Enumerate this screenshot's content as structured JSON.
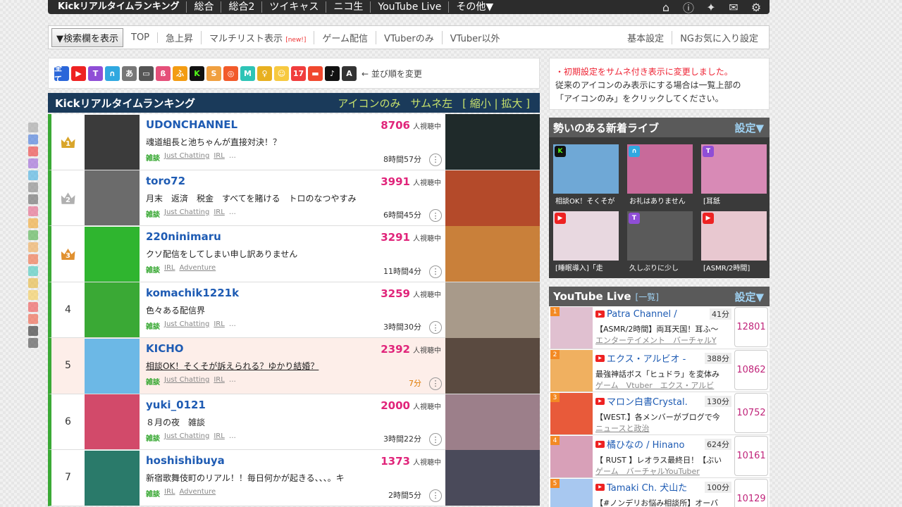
{
  "topnav": {
    "items": [
      "Kickリアルタイムランキング",
      "総合",
      "総合2",
      "ツイキャス",
      "ニコ生",
      "YouTube Live",
      "その他▼"
    ],
    "icons": [
      "home-icon",
      "info-icon",
      "twitter-icon",
      "mail-icon",
      "gear-icon"
    ]
  },
  "submenu": {
    "search_button": "▼検索欄を表示",
    "left": [
      "TOP",
      "急上昇",
      "マルチリスト表示",
      "ゲーム配信",
      "VTuberのみ",
      "VTuber以外"
    ],
    "new_badge": "[new!]",
    "right": [
      "基本設定",
      "NGお気に入り設定"
    ]
  },
  "platforms": {
    "icons": [
      {
        "name": "all-icon",
        "label": "全て",
        "color": "#2a66d9"
      },
      {
        "name": "youtube-icon",
        "label": "▶",
        "color": "#e22"
      },
      {
        "name": "twitch-icon",
        "label": "T",
        "color": "#8f4ed6"
      },
      {
        "name": "openrec-icon",
        "label": "∩",
        "color": "#30a8e0"
      },
      {
        "name": "whowatch-icon",
        "label": "あ",
        "color": "#777"
      },
      {
        "name": "niconico-icon",
        "label": "▭",
        "color": "#555"
      },
      {
        "name": "mildom-icon",
        "label": "ß",
        "color": "#e5507a"
      },
      {
        "name": "furu-icon",
        "label": "ふ",
        "color": "#f39c12"
      },
      {
        "name": "kick-icon",
        "label": "K",
        "color": "#53fc18"
      },
      {
        "name": "showroom-icon",
        "label": "S",
        "color": "#f0a040"
      },
      {
        "name": "17live-circle-icon",
        "label": "◎",
        "color": "#f25a2a"
      },
      {
        "name": "mirrativ-icon",
        "label": "M",
        "color": "#2ec4b6"
      },
      {
        "name": "bulb-icon",
        "label": "♀",
        "color": "#e8b020"
      },
      {
        "name": "pococha-icon",
        "label": "☺",
        "color": "#f7c940"
      },
      {
        "name": "seventeen-icon",
        "label": "17",
        "color": "#f03d3d"
      },
      {
        "name": "line-live-icon",
        "label": "▬",
        "color": "#f0482e"
      },
      {
        "name": "tiktok-icon",
        "label": "♪",
        "color": "#111"
      },
      {
        "name": "twitcasting-icon",
        "label": "A",
        "color": "#333"
      }
    ],
    "sort_link": "← 並び順を変更"
  },
  "ranking": {
    "title": "Kickリアルタイムランキング",
    "options": [
      "アイコンのみ",
      "サムネ左",
      "[ 縮小 | 拡大 ]"
    ],
    "viewers_label": "人視聴中",
    "genre_label": "雑談",
    "rows": [
      {
        "rank": "1",
        "crown": "1",
        "name": "UDONCHANNEL",
        "viewers": "8706",
        "title": "魂道組長と池ちゃんが直接対決！？",
        "tags": [
          "Just Chatting",
          "IRL",
          "…"
        ],
        "duration": "8時間57分",
        "avatar": "#3b3b3b",
        "thumb": "#1f2a2a",
        "highlight": false
      },
      {
        "rank": "2",
        "crown": "2",
        "name": "toro72",
        "viewers": "3991",
        "title": "月末　返済　税金　すべてを賭ける　トロのなつやすみ",
        "tags": [
          "Just Chatting",
          "IRL",
          "…"
        ],
        "duration": "6時間45分",
        "avatar": "#6b6b6b",
        "thumb": "#b44a2a",
        "highlight": false
      },
      {
        "rank": "3",
        "crown": "3",
        "name": "220ninimaru",
        "viewers": "3291",
        "title": "クソ配信をしてしまい申し訳ありません",
        "tags": [
          "IRL",
          "Adventure"
        ],
        "duration": "11時間4分",
        "avatar": "#2fb52f",
        "thumb": "#c9803a",
        "highlight": false
      },
      {
        "rank": "4",
        "crown": "",
        "name": "komachik1221k",
        "viewers": "3259",
        "title": "色々ある配信界",
        "tags": [
          "Just Chatting",
          "IRL",
          "…"
        ],
        "duration": "3時間30分",
        "avatar": "#3aa935",
        "thumb": "#a89a8a",
        "highlight": false
      },
      {
        "rank": "5",
        "crown": "",
        "name": "KICHO",
        "viewers": "2392",
        "title": "相談OK！そくそが訴えられる？ゆかり結婚？",
        "tags": [
          "Just Chatting",
          "IRL",
          "…"
        ],
        "duration": "7分",
        "avatar": "#6cb8e6",
        "thumb": "#5a4a40",
        "highlight": true
      },
      {
        "rank": "6",
        "crown": "",
        "name": "yuki_0121",
        "viewers": "2000",
        "title": "８月の夜　雑談",
        "tags": [
          "Just Chatting",
          "IRL",
          "…"
        ],
        "duration": "3時間22分",
        "avatar": "#d24a6a",
        "thumb": "#9c7f8a",
        "highlight": false
      },
      {
        "rank": "7",
        "crown": "",
        "name": "hoshishibuya",
        "viewers": "1373",
        "title": "新宿歌舞伎町のリアル！！毎日何かが起きる、、、。キ",
        "tags": [
          "IRL",
          "Adventure"
        ],
        "duration": "2時間5分",
        "avatar": "#2a7a6a",
        "thumb": "#4a4a5a",
        "highlight": false
      }
    ]
  },
  "notice": {
    "line1": "・初期設定をサムネ付き表示に変更しました。",
    "line2": "従来のアイコンのみ表示にする場合は一覧上部の",
    "line3": "「アイコンのみ」をクリックしてください。"
  },
  "newlive": {
    "title": "勢いのある新着ライブ",
    "setting": "設定▼",
    "cards": [
      {
        "caption": "相談OK！そくそが",
        "badge": "K",
        "badge_color": "#53fc18",
        "img": "#6fa8d6"
      },
      {
        "caption": "お礼はありません",
        "badge": "∩",
        "badge_color": "#30a8e0",
        "img": "#c86a9a"
      },
      {
        "caption": "[耳舐",
        "badge": "T",
        "badge_color": "#8f4ed6",
        "img": "#d88ab6"
      },
      {
        "caption": "[睡眠導入]「走",
        "badge": "▶",
        "badge_color": "#e22",
        "img": "#e8d8e0"
      },
      {
        "caption": "久しぶりに少し",
        "badge": "T",
        "badge_color": "#8f4ed6",
        "img": "#5a5a5a"
      },
      {
        "caption": "[ASMR/2時間]",
        "badge": "▶",
        "badge_color": "#e22",
        "img": "#e8c8d0"
      }
    ]
  },
  "youtube": {
    "title": "YouTube Live",
    "more": "[一覧]",
    "setting": "設定▼",
    "items": [
      {
        "rank": "1",
        "channel": "Patra Channel /",
        "mins": "41分",
        "title": "【ASMR/2時間】両耳天国！耳ふ〜",
        "category": "エンターテイメント　バーチャルY",
        "count": "12801",
        "img": "#e0c0d0"
      },
      {
        "rank": "2",
        "channel": "エクス・アルビオ -",
        "mins": "388分",
        "title": "最強神話ボス「ヒュドラ」を変体み",
        "category": "ゲーム　Vtuber　エクス・アルビ",
        "count": "10862",
        "img": "#f0b060"
      },
      {
        "rank": "3",
        "channel": "マロン白書Crystal.",
        "mins": "130分",
        "title": "【WEST.】各メンバーがブログで今",
        "category": "ニュースと政治",
        "count": "10752",
        "img": "#e85a3a"
      },
      {
        "rank": "4",
        "channel": "橘ひなの / Hinano",
        "mins": "624分",
        "title": "【 RUST 】レオラス最終日！【ぶい",
        "category": "ゲーム　バーチャルYouTuber",
        "count": "10161",
        "img": "#d8a0b8"
      },
      {
        "rank": "5",
        "channel": "Tamaki Ch. 犬山た",
        "mins": "100分",
        "title": "【#ノンデリお悩み相談所】オーバ",
        "category": "",
        "count": "10129",
        "img": "#a8c8f0"
      }
    ]
  },
  "sidestrip": [
    {
      "name": "edit-icon",
      "color": "#999"
    },
    {
      "name": "all-side-icon",
      "color": "#2a66d9"
    },
    {
      "name": "youtube-side-icon",
      "color": "#e22"
    },
    {
      "name": "twitch-side-icon",
      "color": "#8f4ed6"
    },
    {
      "name": "openrec-side-icon",
      "color": "#30a8e0"
    },
    {
      "name": "whowatch-side-icon",
      "color": "#777"
    },
    {
      "name": "niconico-side-icon",
      "color": "#555"
    },
    {
      "name": "mildom-side-icon",
      "color": "#e5507a"
    },
    {
      "name": "furu-side-icon",
      "color": "#f39c12"
    },
    {
      "name": "kick-side-icon",
      "color": "#3aa935"
    },
    {
      "name": "showroom-side-icon",
      "color": "#f0a040"
    },
    {
      "name": "17live-side-icon",
      "color": "#f25a2a"
    },
    {
      "name": "mirrativ-side-icon",
      "color": "#2ec4b6"
    },
    {
      "name": "bulb-side-icon",
      "color": "#e8b020"
    },
    {
      "name": "pococha-side-icon",
      "color": "#f7c940"
    },
    {
      "name": "seventeen-side-icon",
      "color": "#f03d3d"
    },
    {
      "name": "line-live-side-icon",
      "color": "#f0482e"
    },
    {
      "name": "tiktok-side-icon",
      "color": "#111"
    },
    {
      "name": "twitcasting-side-icon",
      "color": "#333"
    }
  ]
}
